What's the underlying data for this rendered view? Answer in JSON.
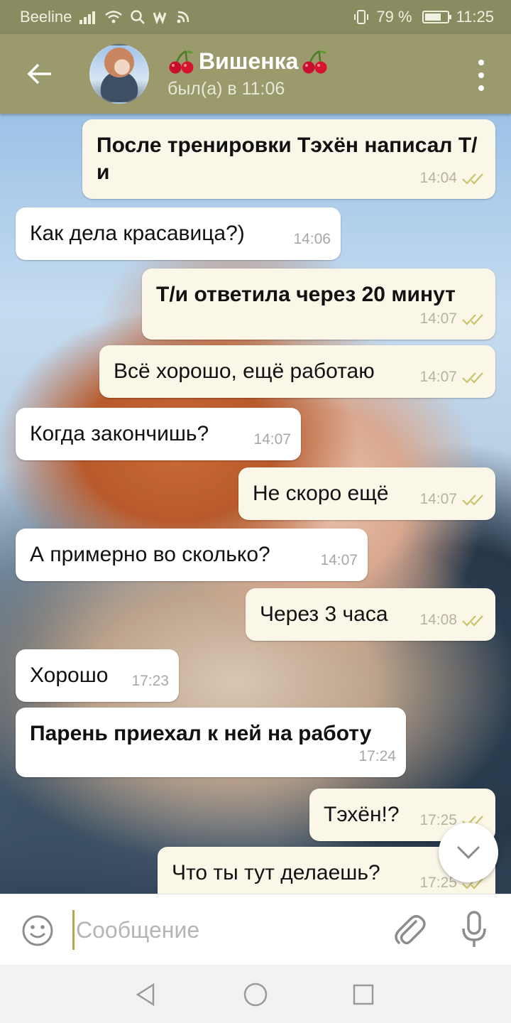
{
  "status_bar": {
    "carrier": "Beeline",
    "battery": "79 %",
    "time": "11:25"
  },
  "header": {
    "title": "Вишенка",
    "status": "был(а) в 11:06"
  },
  "messages": [
    {
      "text": "После тренировки Тэхён написал Т/и",
      "time": "14:04"
    },
    {
      "text": "Как дела красавица?)",
      "time": "14:06"
    },
    {
      "text": "Т/и ответила через 20 минут",
      "time": "14:07"
    },
    {
      "text": "Всё хорошо, ещё работаю",
      "time": "14:07"
    },
    {
      "text": "Когда закончишь?",
      "time": "14:07"
    },
    {
      "text": "Не скоро ещё",
      "time": "14:07"
    },
    {
      "text": "А примерно во сколько?",
      "time": "14:07"
    },
    {
      "text": "Через 3 часа",
      "time": "14:08"
    },
    {
      "text": "Хорошо",
      "time": "17:23"
    },
    {
      "text": "Парень приехал к ней на работу",
      "time": "17:24"
    },
    {
      "text": "Тэхён!?",
      "time": "17:25"
    },
    {
      "text": "Что ты тут делаешь?",
      "time": "17:25"
    }
  ],
  "input": {
    "placeholder": "Сообщение"
  },
  "colors": {
    "header": "#9a9a6c",
    "status_bar": "#8b8b62",
    "outgoing_bubble": "#fbf7e8",
    "incoming_bubble": "#ffffff",
    "read_check": "#c9c46a"
  }
}
